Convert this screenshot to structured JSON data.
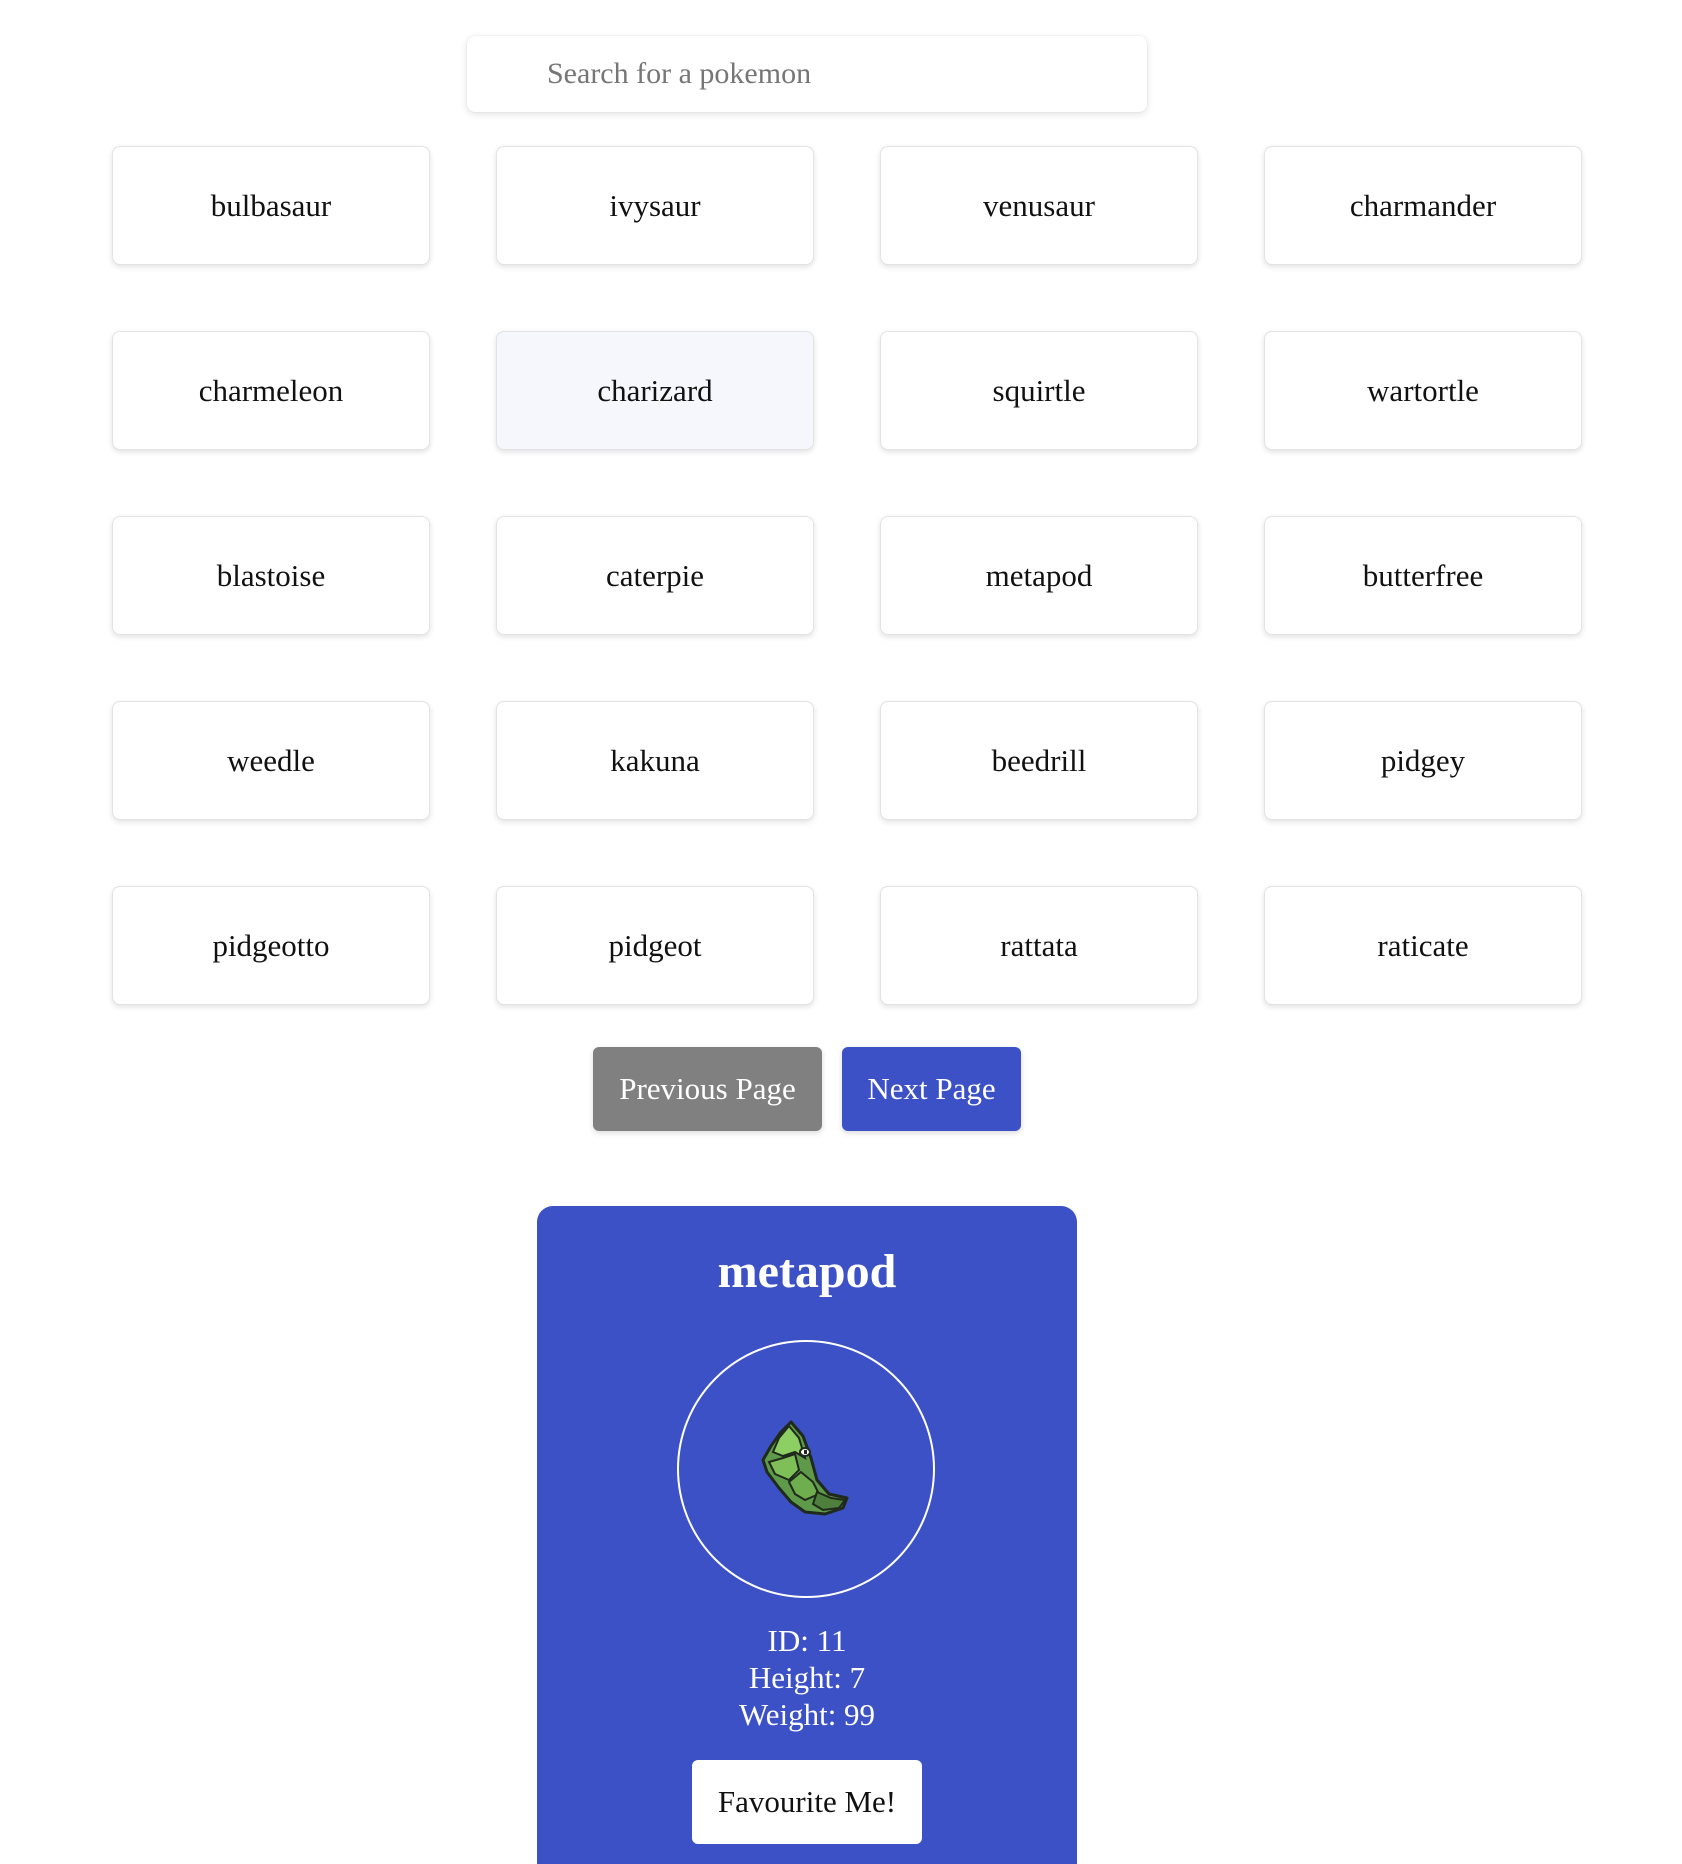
{
  "search": {
    "placeholder": "Search for a pokemon",
    "value": ""
  },
  "pokemon_list": [
    "bulbasaur",
    "ivysaur",
    "venusaur",
    "charmander",
    "charmeleon",
    "charizard",
    "squirtle",
    "wartortle",
    "blastoise",
    "caterpie",
    "metapod",
    "butterfree",
    "weedle",
    "kakuna",
    "beedrill",
    "pidgey",
    "pidgeotto",
    "pidgeot",
    "rattata",
    "raticate"
  ],
  "pagination": {
    "previous_label": "Previous Page",
    "next_label": "Next Page"
  },
  "detail": {
    "name": "metapod",
    "sprite_icon": "metapod-sprite-icon",
    "id_line": "ID: 11",
    "height_line": "Height: 7",
    "weight_line": "Weight: 99",
    "favourite_label": "Favourite Me!"
  },
  "colors": {
    "accent": "#3d51c6",
    "prev_button": "#808080",
    "hover_card": "#f6f7fd"
  }
}
